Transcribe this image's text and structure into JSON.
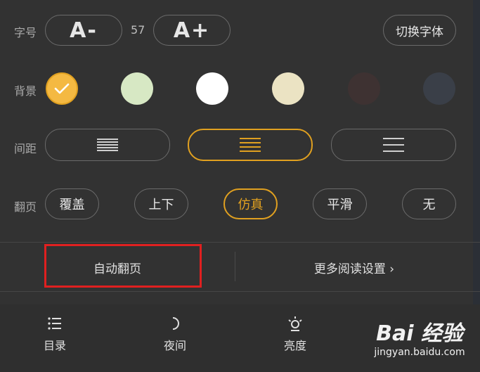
{
  "font": {
    "label": "字号",
    "decrease_label": "A-",
    "size_value": "57",
    "increase_label": "A+",
    "switch_font_label": "切换字体"
  },
  "background": {
    "label": "背景",
    "swatches": [
      {
        "color": "#f4b942",
        "selected": true
      },
      {
        "color": "#d7e8c4",
        "selected": false
      },
      {
        "color": "#ffffff",
        "selected": false
      },
      {
        "color": "#ebe3c3",
        "selected": false
      },
      {
        "color": "#3e3232",
        "selected": false
      },
      {
        "color": "#3a3f48",
        "selected": false
      }
    ]
  },
  "spacing": {
    "label": "间距",
    "options": [
      "compact",
      "medium",
      "loose"
    ],
    "selected": "medium"
  },
  "page_turn": {
    "label": "翻页",
    "options": [
      "覆盖",
      "上下",
      "仿真",
      "平滑",
      "无"
    ],
    "selected": "仿真"
  },
  "actions": {
    "auto_page_label": "自动翻页",
    "more_settings_label": "更多阅读设置 ›"
  },
  "nav": {
    "catalog": "目录",
    "night": "夜间",
    "brightness": "亮度"
  },
  "watermark": {
    "brand": "Bai 经验",
    "url": "jingyan.baidu.com"
  },
  "colors": {
    "accent": "#e0a020",
    "highlight_box": "#e02020"
  }
}
